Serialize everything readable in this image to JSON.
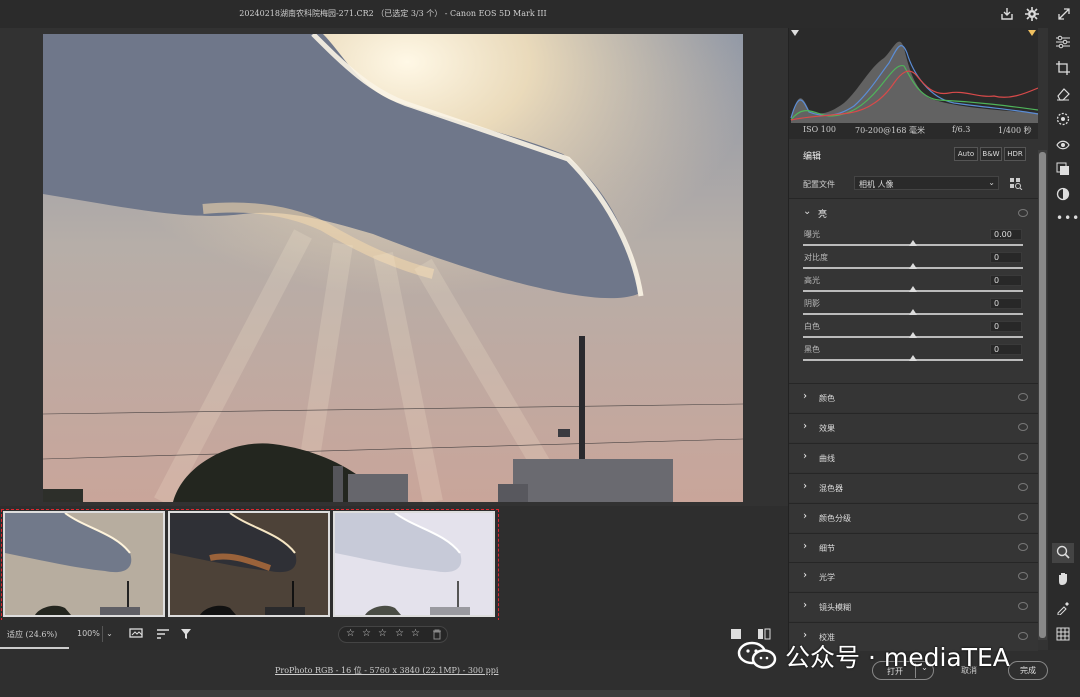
{
  "window": {
    "title": "20240218湖南农科院梅园-271.CR2 （已选定 3/3 个） - Canon EOS 5D Mark III"
  },
  "histogram": {
    "exif": [
      "ISO 100",
      "70-200@168 毫米",
      "f/6.3",
      "1/400 秒"
    ]
  },
  "edit": {
    "header": "编辑",
    "auto_label": "Auto",
    "bw_label": "B&W",
    "hdr_label": "HDR",
    "profile_label": "配置文件",
    "profile_value": "相机 人像"
  },
  "light": {
    "title": "亮",
    "sliders": [
      {
        "label": "曝光",
        "value": "0.00",
        "level": 0.5
      },
      {
        "label": "对比度",
        "value": "0",
        "level": 0.5
      },
      {
        "label": "高光",
        "value": "0",
        "level": 0.5
      },
      {
        "label": "阴影",
        "value": "0",
        "level": 0.5
      },
      {
        "label": "白色",
        "value": "0",
        "level": 0.5
      },
      {
        "label": "黑色",
        "value": "0",
        "level": 0.5
      }
    ]
  },
  "sections": [
    "颜色",
    "效果",
    "曲线",
    "混色器",
    "颜色分级",
    "细节",
    "光学",
    "镜头模糊",
    "校准"
  ],
  "bottom": {
    "zoom_fit": "适应 (24.6%)",
    "zoom_100": "100%",
    "info": "ProPhoto RGB - 16 位 - 5760 x 3840 (22.1MP) - 300 ppi",
    "open_label": "打开",
    "cancel_label": "取消",
    "done_label": "完成"
  },
  "watermark": {
    "text": "公众号 · mediaTEA"
  },
  "rating": {
    "stars": [
      "☆",
      "☆",
      "☆",
      "☆",
      "☆"
    ]
  },
  "colors": {
    "selection_dash": "#e0262e",
    "panel_bg": "#333333"
  }
}
